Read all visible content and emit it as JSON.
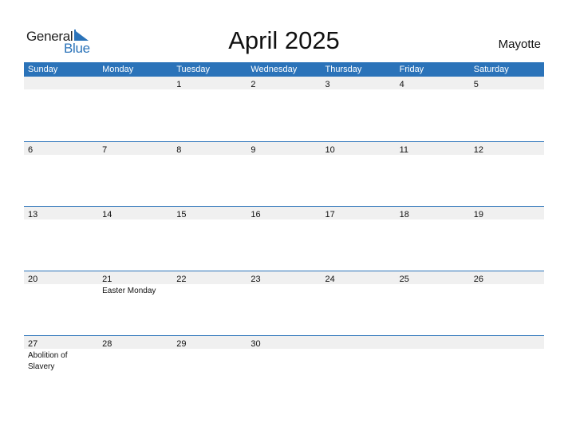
{
  "logo": {
    "word1": "General",
    "word2": "Blue"
  },
  "title": "April 2025",
  "country": "Mayotte",
  "colors": {
    "accent": "#2b73b9",
    "date_band": "#f0f0f0"
  },
  "weekdays": [
    "Sunday",
    "Monday",
    "Tuesday",
    "Wednesday",
    "Thursday",
    "Friday",
    "Saturday"
  ],
  "weeks": [
    {
      "days": [
        {
          "n": "",
          "h": ""
        },
        {
          "n": "",
          "h": ""
        },
        {
          "n": "1",
          "h": ""
        },
        {
          "n": "2",
          "h": ""
        },
        {
          "n": "3",
          "h": ""
        },
        {
          "n": "4",
          "h": ""
        },
        {
          "n": "5",
          "h": ""
        }
      ]
    },
    {
      "days": [
        {
          "n": "6",
          "h": ""
        },
        {
          "n": "7",
          "h": ""
        },
        {
          "n": "8",
          "h": ""
        },
        {
          "n": "9",
          "h": ""
        },
        {
          "n": "10",
          "h": ""
        },
        {
          "n": "11",
          "h": ""
        },
        {
          "n": "12",
          "h": ""
        }
      ]
    },
    {
      "days": [
        {
          "n": "13",
          "h": ""
        },
        {
          "n": "14",
          "h": ""
        },
        {
          "n": "15",
          "h": ""
        },
        {
          "n": "16",
          "h": ""
        },
        {
          "n": "17",
          "h": ""
        },
        {
          "n": "18",
          "h": ""
        },
        {
          "n": "19",
          "h": ""
        }
      ]
    },
    {
      "days": [
        {
          "n": "20",
          "h": ""
        },
        {
          "n": "21",
          "h": "Easter Monday"
        },
        {
          "n": "22",
          "h": ""
        },
        {
          "n": "23",
          "h": ""
        },
        {
          "n": "24",
          "h": ""
        },
        {
          "n": "25",
          "h": ""
        },
        {
          "n": "26",
          "h": ""
        }
      ]
    },
    {
      "days": [
        {
          "n": "27",
          "h": "Abolition of Slavery"
        },
        {
          "n": "28",
          "h": ""
        },
        {
          "n": "29",
          "h": ""
        },
        {
          "n": "30",
          "h": ""
        },
        {
          "n": "",
          "h": ""
        },
        {
          "n": "",
          "h": ""
        },
        {
          "n": "",
          "h": ""
        }
      ]
    }
  ]
}
